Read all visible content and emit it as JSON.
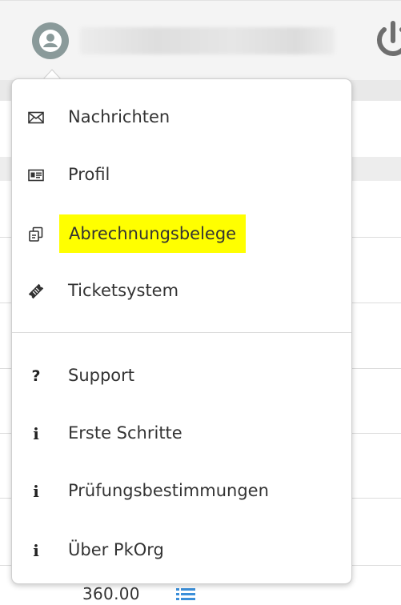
{
  "header": {
    "avatar_icon": "user-avatar-icon",
    "power_icon": "power-icon"
  },
  "menu": {
    "items": [
      {
        "label": "Nachrichten",
        "icon": "envelope-icon",
        "highlighted": false
      },
      {
        "label": "Profil",
        "icon": "id-card-icon",
        "highlighted": false
      },
      {
        "label": "Abrechnungsbelege",
        "icon": "copy-documents-icon",
        "highlighted": true
      },
      {
        "label": "Ticketsystem",
        "icon": "ticket-icon",
        "highlighted": false
      }
    ],
    "info_items": [
      {
        "label": "Support",
        "icon": "question-icon"
      },
      {
        "label": "Erste Schritte",
        "icon": "info-icon"
      },
      {
        "label": "Prüfungsbestimmungen",
        "icon": "info-icon"
      },
      {
        "label": "Über PkOrg",
        "icon": "info-icon"
      }
    ]
  },
  "background": {
    "amount": "360.00",
    "list_icon": "list-icon"
  },
  "colors": {
    "highlight": "#ffff00",
    "avatar": "#8a9a9a",
    "accent_blue": "#3b8fd9"
  }
}
